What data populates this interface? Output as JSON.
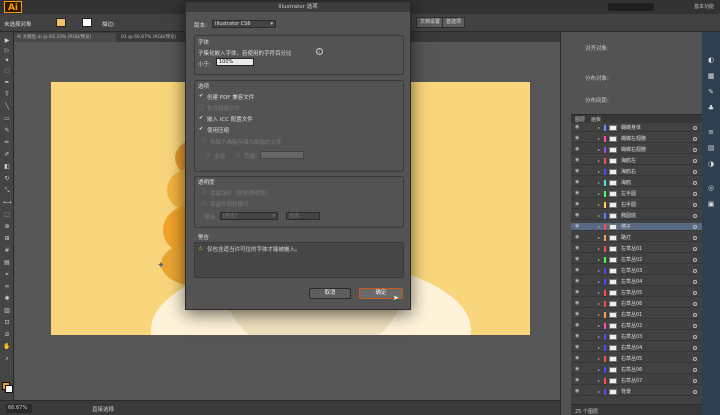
{
  "app": {
    "logo": "Ai",
    "workspace": "基本功能"
  },
  "control_bar": {
    "selection_label": "未选择对象",
    "stroke_label": "描边:",
    "btn_doc_setup": "文档设置",
    "btn_prefs": "首选项"
  },
  "tabs": [
    "Ai 大鲸鱼.ai @ 63.33% (RGB/预览)",
    "01 @ 66.67% (RGB/预览)"
  ],
  "status": {
    "zoom": "66.67%",
    "tool": "直接选择"
  },
  "right_panel": {
    "align_to": "对齐对象:",
    "distribute_objects": "分布对象:",
    "distribute_spacing": "分布间距:"
  },
  "layers": {
    "tabs": [
      "图层",
      "画板"
    ],
    "footer": "25 个图层",
    "items": [
      {
        "name": "蝴蝶身体",
        "color": "#4aa0ff"
      },
      {
        "name": "蝴蝶左翅膀",
        "color": "#ff4ac0"
      },
      {
        "name": "蝴蝶右翅膀",
        "color": "#a04aff"
      },
      {
        "name": "海鸥左",
        "color": "#ff4a4a"
      },
      {
        "name": "海鸥右",
        "color": "#4a4aff"
      },
      {
        "name": "海鸥",
        "color": "#4ae0ff"
      },
      {
        "name": "左手圆",
        "color": "#4aff70"
      },
      {
        "name": "右手圆",
        "color": "#ffd24a"
      },
      {
        "name": "椭圆底",
        "color": "#4a8aff"
      },
      {
        "name": "椅子",
        "color": "#ff4a4a"
      },
      {
        "name": "路灯",
        "color": "#ff9a4a"
      },
      {
        "name": "左草丛01",
        "color": "#ff4a4a"
      },
      {
        "name": "左草丛02",
        "color": "#4aff4a"
      },
      {
        "name": "左草丛03",
        "color": "#4a4aff"
      },
      {
        "name": "左草丛04",
        "color": "#4a4aff"
      },
      {
        "name": "左草丛05",
        "color": "#ff4a4a"
      },
      {
        "name": "右草丛06",
        "color": "#ff4a4a"
      },
      {
        "name": "右草丛01",
        "color": "#ffa04a"
      },
      {
        "name": "右草丛02",
        "color": "#ff4ac0"
      },
      {
        "name": "右草丛03",
        "color": "#4a4aff"
      },
      {
        "name": "右草丛04",
        "color": "#4a4aff"
      },
      {
        "name": "右草丛05",
        "color": "#ff4a4a"
      },
      {
        "name": "右草丛06",
        "color": "#4a4aff"
      },
      {
        "name": "右草丛07",
        "color": "#ff4a4a"
      },
      {
        "name": "背景",
        "color": "#4a4aff"
      }
    ],
    "selected_index": 9
  },
  "dialog": {
    "title": "Illustrator 选项",
    "version_label": "版本:",
    "version_value": "Illustrator CS6",
    "fonts_section": "字体",
    "fonts_desc": "子集化嵌入字体，若使用的字符百分比",
    "fonts_less_than": "小于:",
    "fonts_percent": "100%",
    "options_section": "选项",
    "opt_pdf": "创建 PDF 兼容文件",
    "opt_linked": "包含链接文件",
    "opt_icc": "嵌入 ICC 配置文件",
    "opt_compress": "使用压缩",
    "opt_artboards": "将每个画板存储为单独的文件",
    "opt_all": "全部",
    "opt_range": "范围:",
    "transparency_section": "透明度",
    "trans_keep_paths": "保留路径（放弃透明度）",
    "trans_keep_appearance": "保留外观和叠印",
    "trans_preset_label": "预设:",
    "trans_preset_value": "[自定]",
    "trans_custom_btn": "自定...",
    "warning_section": "警告",
    "warning_text": "仅包含适当许可位的字体才能被嵌入。",
    "cancel": "取消",
    "ok": "确定"
  }
}
